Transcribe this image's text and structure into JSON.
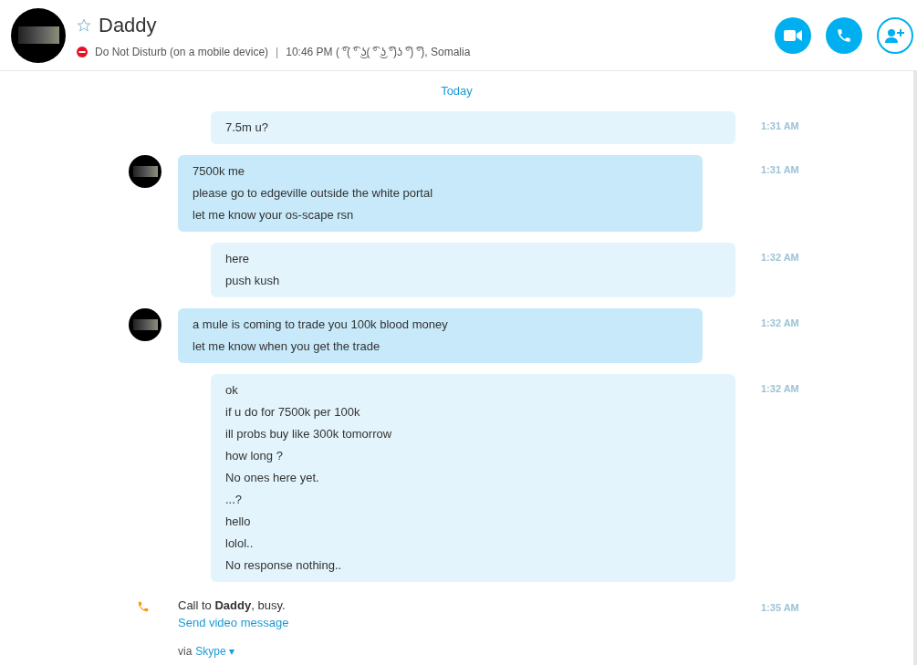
{
  "contact": {
    "name": "Daddy",
    "favorite": false,
    "status": "Do Not Disturb (on a mobile device)",
    "separator": "|",
    "details": "10:46 PM ( ͡°( ͡° ͜ʖ( ͡° ͜ʖ ͡°)ʖ ͡°) ͡°), Somalia"
  },
  "date_divider": "Today",
  "messages": [
    {
      "kind": "outgoing",
      "lines": [
        "7.5m u?"
      ],
      "time": "1:31 AM"
    },
    {
      "kind": "incoming",
      "lines": [
        "7500k me",
        "please go to edgeville outside the white portal",
        "let me know your os-scape rsn"
      ],
      "time": "1:31 AM"
    },
    {
      "kind": "outgoing",
      "lines": [
        "here",
        "push kush"
      ],
      "time": "1:32 AM"
    },
    {
      "kind": "incoming",
      "lines": [
        "a mule is coming to trade you 100k blood money",
        "let me know when you get the trade"
      ],
      "time": "1:32 AM"
    },
    {
      "kind": "outgoing",
      "lines": [
        "ok",
        "if u do for 7500k per 100k",
        "ill probs buy like 300k tomorrow",
        "how long ?",
        "No ones here yet.",
        "...?",
        "hello",
        "lolol..",
        "No response nothing.."
      ],
      "time": "1:32 AM"
    },
    {
      "kind": "call",
      "lines": [
        "Call to **Daddy**, busy."
      ],
      "link": "Send video message",
      "time": "1:35 AM"
    }
  ],
  "footer": {
    "prefix": "via",
    "link": "Skype ▾"
  }
}
